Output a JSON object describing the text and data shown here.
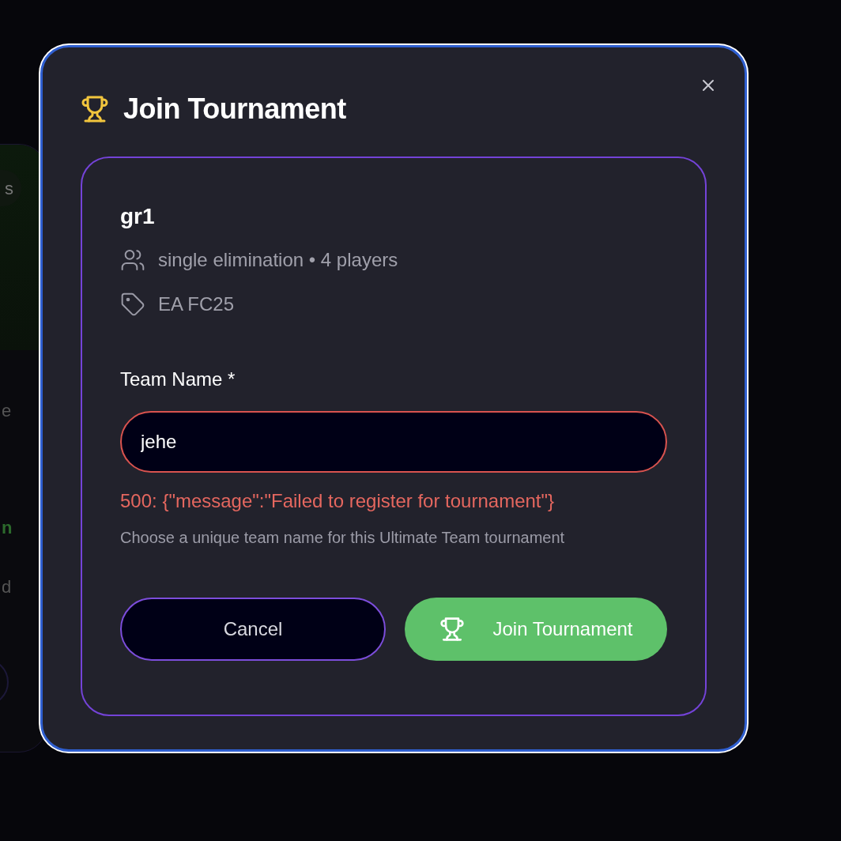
{
  "background_card": {
    "badge": "s",
    "line_1": "e",
    "line_2": "n",
    "line_3": "d"
  },
  "dialog": {
    "title": "Join Tournament",
    "tournament": {
      "name": "gr1",
      "format": "single elimination • 4 players",
      "game": "EA FC25"
    },
    "team_name": {
      "label": "Team Name *",
      "value": "jehe",
      "invalid": true
    },
    "error": "500: {\"message\":\"Failed to register for tournament\"}",
    "hint": "Choose a unique team name for this Ultimate Team tournament",
    "buttons": [
      {
        "kind": "secondary",
        "label": "Cancel"
      },
      {
        "kind": "primary",
        "label": "Join Tournament"
      }
    ]
  }
}
